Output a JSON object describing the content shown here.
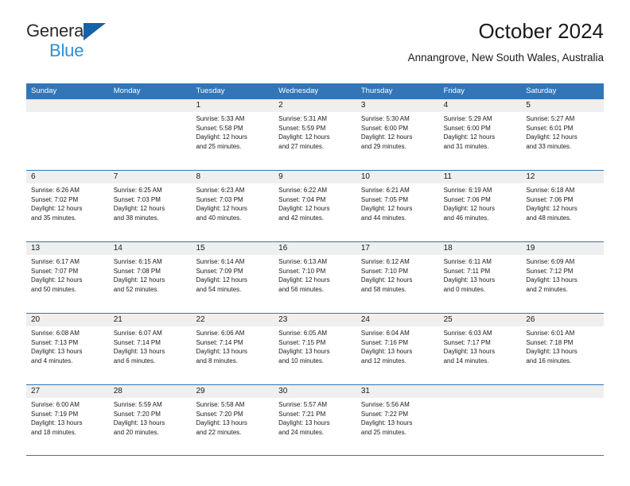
{
  "logo": {
    "word_top": "General",
    "word_bottom": "Blue",
    "triangle_color": "#1462a8",
    "blue_color": "#2e8fd6"
  },
  "header": {
    "title": "October 2024",
    "subtitle": "Annangrove, New South Wales, Australia"
  },
  "theme": {
    "header_blue": "#3276b8",
    "band_gray": "#efefef",
    "text": "#1a1a1a"
  },
  "weekdays": [
    "Sunday",
    "Monday",
    "Tuesday",
    "Wednesday",
    "Thursday",
    "Friday",
    "Saturday"
  ],
  "weeks": [
    [
      {
        "day": "",
        "sunrise": "",
        "sunset": "",
        "daylight1": "",
        "daylight2": "",
        "empty": true
      },
      {
        "day": "",
        "sunrise": "",
        "sunset": "",
        "daylight1": "",
        "daylight2": "",
        "empty": true
      },
      {
        "day": "1",
        "sunrise": "Sunrise: 5:33 AM",
        "sunset": "Sunset: 5:58 PM",
        "daylight1": "Daylight: 12 hours",
        "daylight2": "and 25 minutes."
      },
      {
        "day": "2",
        "sunrise": "Sunrise: 5:31 AM",
        "sunset": "Sunset: 5:59 PM",
        "daylight1": "Daylight: 12 hours",
        "daylight2": "and 27 minutes."
      },
      {
        "day": "3",
        "sunrise": "Sunrise: 5:30 AM",
        "sunset": "Sunset: 6:00 PM",
        "daylight1": "Daylight: 12 hours",
        "daylight2": "and 29 minutes."
      },
      {
        "day": "4",
        "sunrise": "Sunrise: 5:29 AM",
        "sunset": "Sunset: 6:00 PM",
        "daylight1": "Daylight: 12 hours",
        "daylight2": "and 31 minutes."
      },
      {
        "day": "5",
        "sunrise": "Sunrise: 5:27 AM",
        "sunset": "Sunset: 6:01 PM",
        "daylight1": "Daylight: 12 hours",
        "daylight2": "and 33 minutes."
      }
    ],
    [
      {
        "day": "6",
        "sunrise": "Sunrise: 6:26 AM",
        "sunset": "Sunset: 7:02 PM",
        "daylight1": "Daylight: 12 hours",
        "daylight2": "and 35 minutes."
      },
      {
        "day": "7",
        "sunrise": "Sunrise: 6:25 AM",
        "sunset": "Sunset: 7:03 PM",
        "daylight1": "Daylight: 12 hours",
        "daylight2": "and 38 minutes."
      },
      {
        "day": "8",
        "sunrise": "Sunrise: 6:23 AM",
        "sunset": "Sunset: 7:03 PM",
        "daylight1": "Daylight: 12 hours",
        "daylight2": "and 40 minutes."
      },
      {
        "day": "9",
        "sunrise": "Sunrise: 6:22 AM",
        "sunset": "Sunset: 7:04 PM",
        "daylight1": "Daylight: 12 hours",
        "daylight2": "and 42 minutes."
      },
      {
        "day": "10",
        "sunrise": "Sunrise: 6:21 AM",
        "sunset": "Sunset: 7:05 PM",
        "daylight1": "Daylight: 12 hours",
        "daylight2": "and 44 minutes."
      },
      {
        "day": "11",
        "sunrise": "Sunrise: 6:19 AM",
        "sunset": "Sunset: 7:06 PM",
        "daylight1": "Daylight: 12 hours",
        "daylight2": "and 46 minutes."
      },
      {
        "day": "12",
        "sunrise": "Sunrise: 6:18 AM",
        "sunset": "Sunset: 7:06 PM",
        "daylight1": "Daylight: 12 hours",
        "daylight2": "and 48 minutes."
      }
    ],
    [
      {
        "day": "13",
        "sunrise": "Sunrise: 6:17 AM",
        "sunset": "Sunset: 7:07 PM",
        "daylight1": "Daylight: 12 hours",
        "daylight2": "and 50 minutes."
      },
      {
        "day": "14",
        "sunrise": "Sunrise: 6:15 AM",
        "sunset": "Sunset: 7:08 PM",
        "daylight1": "Daylight: 12 hours",
        "daylight2": "and 52 minutes."
      },
      {
        "day": "15",
        "sunrise": "Sunrise: 6:14 AM",
        "sunset": "Sunset: 7:09 PM",
        "daylight1": "Daylight: 12 hours",
        "daylight2": "and 54 minutes."
      },
      {
        "day": "16",
        "sunrise": "Sunrise: 6:13 AM",
        "sunset": "Sunset: 7:10 PM",
        "daylight1": "Daylight: 12 hours",
        "daylight2": "and 56 minutes."
      },
      {
        "day": "17",
        "sunrise": "Sunrise: 6:12 AM",
        "sunset": "Sunset: 7:10 PM",
        "daylight1": "Daylight: 12 hours",
        "daylight2": "and 58 minutes."
      },
      {
        "day": "18",
        "sunrise": "Sunrise: 6:11 AM",
        "sunset": "Sunset: 7:11 PM",
        "daylight1": "Daylight: 13 hours",
        "daylight2": "and 0 minutes."
      },
      {
        "day": "19",
        "sunrise": "Sunrise: 6:09 AM",
        "sunset": "Sunset: 7:12 PM",
        "daylight1": "Daylight: 13 hours",
        "daylight2": "and 2 minutes."
      }
    ],
    [
      {
        "day": "20",
        "sunrise": "Sunrise: 6:08 AM",
        "sunset": "Sunset: 7:13 PM",
        "daylight1": "Daylight: 13 hours",
        "daylight2": "and 4 minutes."
      },
      {
        "day": "21",
        "sunrise": "Sunrise: 6:07 AM",
        "sunset": "Sunset: 7:14 PM",
        "daylight1": "Daylight: 13 hours",
        "daylight2": "and 6 minutes."
      },
      {
        "day": "22",
        "sunrise": "Sunrise: 6:06 AM",
        "sunset": "Sunset: 7:14 PM",
        "daylight1": "Daylight: 13 hours",
        "daylight2": "and 8 minutes."
      },
      {
        "day": "23",
        "sunrise": "Sunrise: 6:05 AM",
        "sunset": "Sunset: 7:15 PM",
        "daylight1": "Daylight: 13 hours",
        "daylight2": "and 10 minutes."
      },
      {
        "day": "24",
        "sunrise": "Sunrise: 6:04 AM",
        "sunset": "Sunset: 7:16 PM",
        "daylight1": "Daylight: 13 hours",
        "daylight2": "and 12 minutes."
      },
      {
        "day": "25",
        "sunrise": "Sunrise: 6:03 AM",
        "sunset": "Sunset: 7:17 PM",
        "daylight1": "Daylight: 13 hours",
        "daylight2": "and 14 minutes."
      },
      {
        "day": "26",
        "sunrise": "Sunrise: 6:01 AM",
        "sunset": "Sunset: 7:18 PM",
        "daylight1": "Daylight: 13 hours",
        "daylight2": "and 16 minutes."
      }
    ],
    [
      {
        "day": "27",
        "sunrise": "Sunrise: 6:00 AM",
        "sunset": "Sunset: 7:19 PM",
        "daylight1": "Daylight: 13 hours",
        "daylight2": "and 18 minutes."
      },
      {
        "day": "28",
        "sunrise": "Sunrise: 5:59 AM",
        "sunset": "Sunset: 7:20 PM",
        "daylight1": "Daylight: 13 hours",
        "daylight2": "and 20 minutes."
      },
      {
        "day": "29",
        "sunrise": "Sunrise: 5:58 AM",
        "sunset": "Sunset: 7:20 PM",
        "daylight1": "Daylight: 13 hours",
        "daylight2": "and 22 minutes."
      },
      {
        "day": "30",
        "sunrise": "Sunrise: 5:57 AM",
        "sunset": "Sunset: 7:21 PM",
        "daylight1": "Daylight: 13 hours",
        "daylight2": "and 24 minutes."
      },
      {
        "day": "31",
        "sunrise": "Sunrise: 5:56 AM",
        "sunset": "Sunset: 7:22 PM",
        "daylight1": "Daylight: 13 hours",
        "daylight2": "and 25 minutes."
      },
      {
        "day": "",
        "sunrise": "",
        "sunset": "",
        "daylight1": "",
        "daylight2": "",
        "empty": true
      },
      {
        "day": "",
        "sunrise": "",
        "sunset": "",
        "daylight1": "",
        "daylight2": "",
        "empty": true
      }
    ]
  ]
}
